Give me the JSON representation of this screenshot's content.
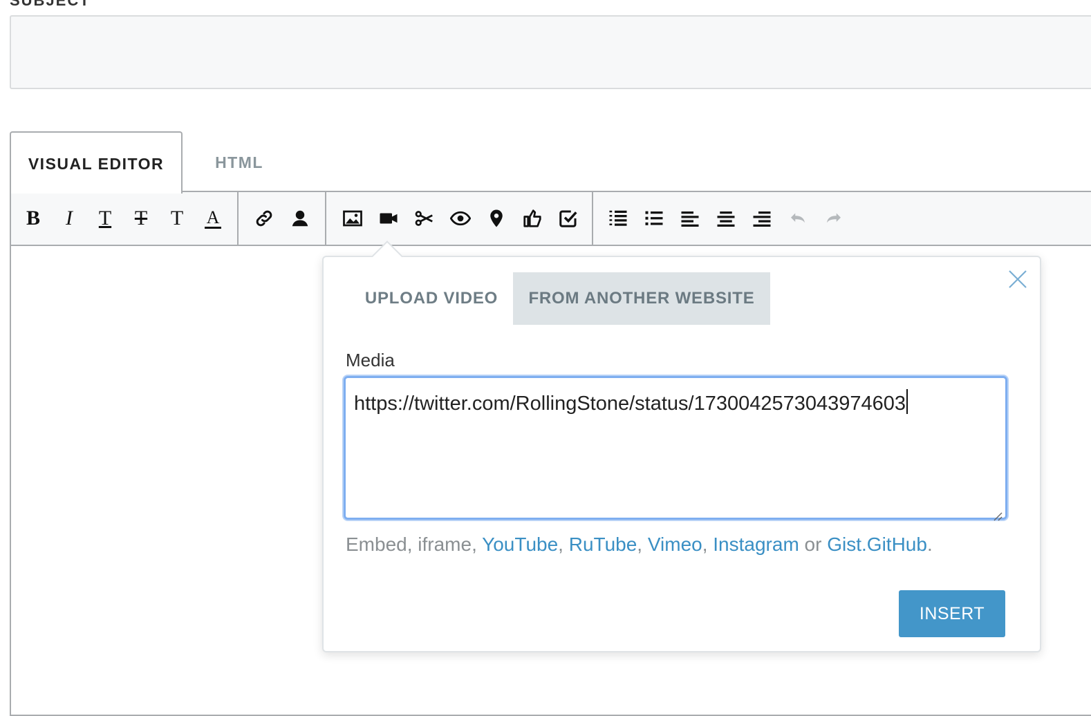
{
  "subject": {
    "label": "SUBJECT",
    "value": ""
  },
  "editor_tabs": [
    {
      "label": "VISUAL EDITOR",
      "active": true
    },
    {
      "label": "HTML",
      "active": false
    }
  ],
  "toolbar": {
    "text_tools": [
      {
        "icon": "bold-icon",
        "glyph": "B"
      },
      {
        "icon": "italic-icon",
        "glyph": "I"
      },
      {
        "icon": "underline-icon",
        "glyph": "T"
      },
      {
        "icon": "strikethrough-icon",
        "glyph": "T"
      },
      {
        "icon": "font-size-icon",
        "glyph": "T"
      },
      {
        "icon": "text-color-icon",
        "glyph": "A"
      }
    ],
    "insert_tools": [
      "link-icon",
      "user-icon"
    ],
    "media_tools": [
      "image-icon",
      "video-icon",
      "cut-icon",
      "spoiler-icon",
      "location-icon",
      "poll-icon",
      "checklist-icon"
    ],
    "format_tools": [
      "ordered-list-icon",
      "bullet-list-icon",
      "align-left-icon",
      "align-center-icon",
      "align-right-icon",
      "undo-icon",
      "redo-icon"
    ]
  },
  "video_dialog": {
    "tabs": [
      {
        "label": "UPLOAD VIDEO",
        "active": false
      },
      {
        "label": "FROM ANOTHER WEBSITE",
        "active": true
      }
    ],
    "media_label": "Media",
    "media_value": "https://twitter.com/RollingStone/status/1730042573043974603",
    "hint": {
      "prefix": "Embed, iframe, ",
      "links": [
        "YouTube",
        "RuTube",
        "Vimeo",
        "Instagram"
      ],
      "separator": ", ",
      "conjunction": " or ",
      "last_link": "Gist.GitHub",
      "suffix": "."
    },
    "insert_label": "INSERT"
  },
  "colors": {
    "accent": "#4396c9",
    "link": "#3a8fc4",
    "focus_border": "#7eaef0",
    "active_tab_bg": "#dde3e6"
  }
}
